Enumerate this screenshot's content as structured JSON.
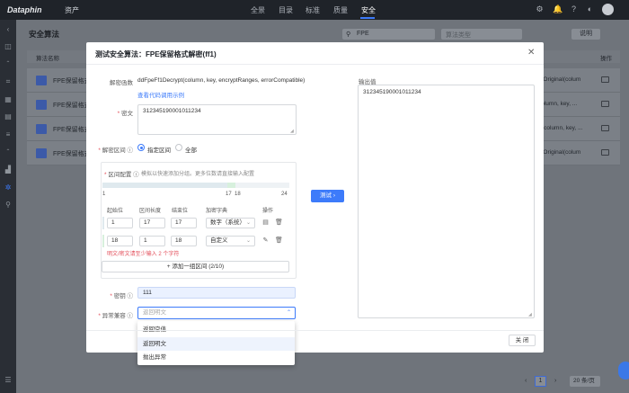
{
  "topbar": {
    "logo": "Dataphin",
    "product": "资产",
    "nav": [
      "全景",
      "目录",
      "标准",
      "质量",
      "安全"
    ],
    "active_nav": "安全"
  },
  "page": {
    "title": "安全算法",
    "search_value": "FPE",
    "select_placeholder": "算法类型",
    "help_label": "说明",
    "table_header_name": "算法名称",
    "table_header_op": "操作",
    "rows": [
      {
        "name": "FPE保留格式",
        "right_text": "ptOriginal(colum"
      },
      {
        "name": "FPE保留格式",
        "right_text": "column, key, ..."
      },
      {
        "name": "FPE保留格式",
        "right_text": "rt(column, key, ..."
      },
      {
        "name": "FPE保留格式",
        "right_text": "ptOriginal(colum"
      }
    ],
    "pager_current": "1",
    "page_size": "20 条/页"
  },
  "modal": {
    "title": "测试安全算法：FPE保留格式解密(ff1)",
    "func_label": "解密函数",
    "func_value": "ddFpeFf1Decrypt(column, key, encryptRanges, errorCompatible)",
    "code_link": "查看代码调用示例",
    "cipher_label": "密文",
    "cipher_value": "312345190001011234",
    "range_label": "解密区间",
    "range_options": [
      "指定区间",
      "全部"
    ],
    "range_selected": "指定区间",
    "config_label": "区间配置",
    "config_hint": "模拟以快速添加分组。更多位数请直接输入配置",
    "ticks": {
      "start": "1",
      "mid_a": "17",
      "mid_b": "18",
      "end": "24"
    },
    "columns": [
      "起始位",
      "区间长度",
      "结束位",
      "加密字典",
      "操作"
    ],
    "ranges": [
      {
        "start": "1",
        "length": "17",
        "end": "17",
        "dict": "数字（系统）"
      },
      {
        "start": "18",
        "length": "1",
        "end": "18",
        "dict": "自定义"
      }
    ],
    "error_text": "明文/密文请至少输入 2 个字符",
    "add_range": "添加一组区间 (2/10)",
    "key_label": "密钥",
    "key_value": "111",
    "exception_label": "异常兼容",
    "exception_placeholder": "返回明文",
    "exception_options": [
      "返回空值",
      "返回明文",
      "抛出异常"
    ],
    "exception_highlighted": "返回明文",
    "test_button": "测试",
    "output_label": "输出值",
    "output_value": "312345190001011234",
    "close_button": "关 闭"
  },
  "colors": {
    "primary": "#3d7bfa",
    "error": "#e34d59",
    "bar_filled": "#dfe9ee",
    "bar_highlight": "#d7f0dd"
  }
}
